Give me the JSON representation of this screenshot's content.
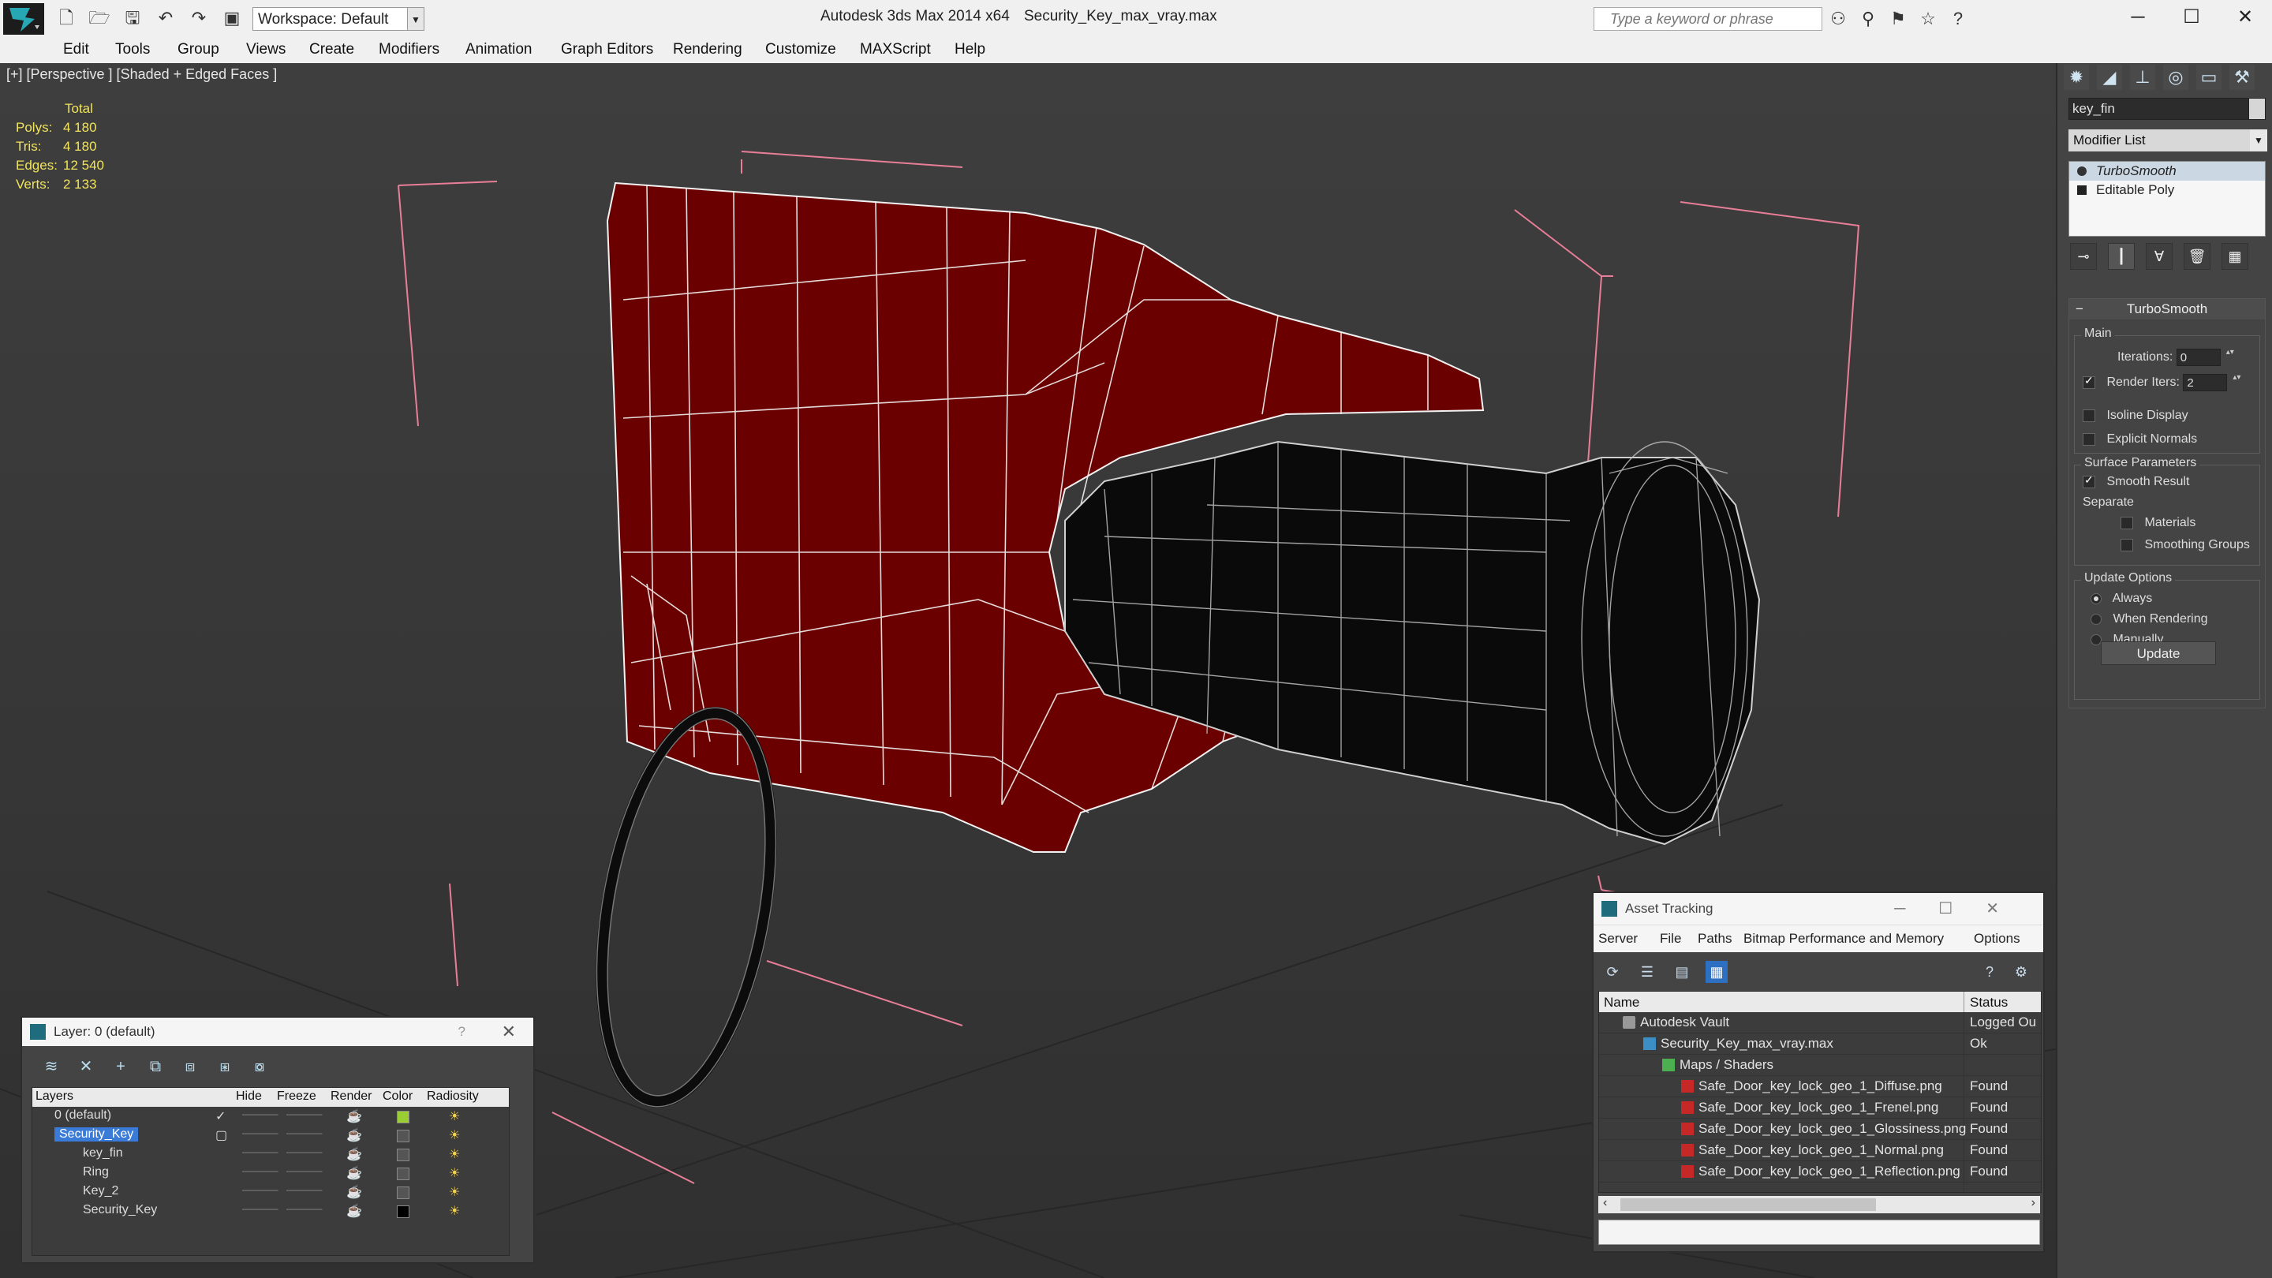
{
  "app": {
    "title": "Autodesk 3ds Max  2014 x64",
    "file": "Security_Key_max_vray.max",
    "workspace": "Workspace: Default",
    "search_placeholder": "Type a keyword or phrase"
  },
  "menu": [
    "Edit",
    "Tools",
    "Group",
    "Views",
    "Create",
    "Modifiers",
    "Animation",
    "Graph Editors",
    "Rendering",
    "Customize",
    "MAXScript",
    "Help"
  ],
  "viewport": {
    "label": "[+] [Perspective ] [Shaded + Edged Faces ]",
    "stats": {
      "header": "Total",
      "rows": [
        {
          "k": "Polys:",
          "v": "4 180"
        },
        {
          "k": "Tris:",
          "v": "4 180"
        },
        {
          "k": "Edges:",
          "v": "12 540"
        },
        {
          "k": "Verts:",
          "v": "2 133"
        }
      ]
    }
  },
  "command_panel": {
    "object_name": "key_fin",
    "modifier_list": "Modifier List",
    "stack": [
      "TurboSmooth",
      "Editable Poly"
    ],
    "rollout": {
      "title": "TurboSmooth",
      "main_label": "Main",
      "iterations_label": "Iterations:",
      "iterations_value": "0",
      "render_iters_label": "Render Iters:",
      "render_iters_value": "2",
      "isoline": "Isoline Display",
      "explicit_normals": "Explicit Normals",
      "surface_label": "Surface Parameters",
      "smooth_result": "Smooth Result",
      "separate_label": "Separate",
      "materials": "Materials",
      "smoothing_groups": "Smoothing Groups",
      "update_label": "Update Options",
      "always": "Always",
      "when_rendering": "When Rendering",
      "manually": "Manually",
      "update_button": "Update"
    }
  },
  "layer_window": {
    "title": "Layer: 0 (default)",
    "help": "?",
    "columns": [
      "Layers",
      "Hide",
      "Freeze",
      "Render",
      "Color",
      "Radiosity"
    ],
    "rows": [
      {
        "name": "0 (default)",
        "color": "#9acd32"
      },
      {
        "name": "Security_Key",
        "color": "#555555"
      },
      {
        "name": "key_fin",
        "color": "#555555"
      },
      {
        "name": "Ring",
        "color": "#555555"
      },
      {
        "name": "Key_2",
        "color": "#555555"
      },
      {
        "name": "Security_Key",
        "color": "#000000"
      }
    ]
  },
  "asset_window": {
    "title": "Asset Tracking",
    "menu": [
      "Server",
      "File",
      "Paths",
      "Bitmap Performance and Memory",
      "Options"
    ],
    "columns": [
      "Name",
      "Status"
    ],
    "rows": [
      {
        "name": "Autodesk Vault",
        "status": "Logged Ou"
      },
      {
        "name": "Security_Key_max_vray.max",
        "status": "Ok"
      },
      {
        "name": "Maps / Shaders",
        "status": ""
      },
      {
        "name": "Safe_Door_key_lock_geo_1_Diffuse.png",
        "status": "Found"
      },
      {
        "name": "Safe_Door_key_lock_geo_1_Frenel.png",
        "status": "Found"
      },
      {
        "name": "Safe_Door_key_lock_geo_1_Glossiness.png",
        "status": "Found"
      },
      {
        "name": "Safe_Door_key_lock_geo_1_Normal.png",
        "status": "Found"
      },
      {
        "name": "Safe_Door_key_lock_geo_1_Reflection.png",
        "status": "Found"
      }
    ]
  }
}
